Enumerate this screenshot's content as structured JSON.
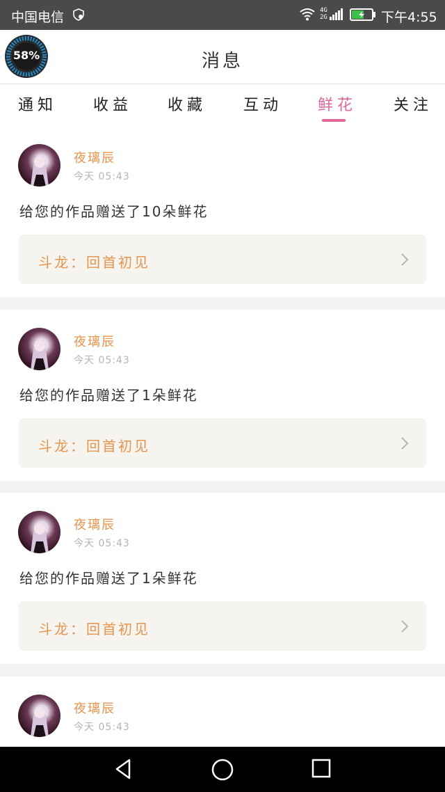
{
  "status_bar": {
    "carrier": "中国电信",
    "net_line1": "4G",
    "net_line2": "2G",
    "clock": "下午4:55"
  },
  "header": {
    "title": "消息",
    "progress_percent": "58%"
  },
  "tabs": [
    {
      "label": "通知"
    },
    {
      "label": "收益"
    },
    {
      "label": "收藏"
    },
    {
      "label": "互动"
    },
    {
      "label": "鲜花",
      "active": true
    },
    {
      "label": "关注"
    }
  ],
  "messages": [
    {
      "username": "夜璃辰",
      "timestamp": "今天 05:43",
      "text": "给您的作品赠送了10朵鲜花",
      "work_title": "斗龙：回首初见"
    },
    {
      "username": "夜璃辰",
      "timestamp": "今天 05:43",
      "text": "给您的作品赠送了1朵鲜花",
      "work_title": "斗龙：回首初见"
    },
    {
      "username": "夜璃辰",
      "timestamp": "今天 05:43",
      "text": "给您的作品赠送了1朵鲜花",
      "work_title": "斗龙：回首初见"
    },
    {
      "username": "夜璃辰",
      "timestamp": "今天 05:43",
      "text": "",
      "work_title": ""
    }
  ],
  "colors": {
    "accent": "#e0669a",
    "username": "#e8944d",
    "card_link_bg": "#f5f4ee"
  }
}
